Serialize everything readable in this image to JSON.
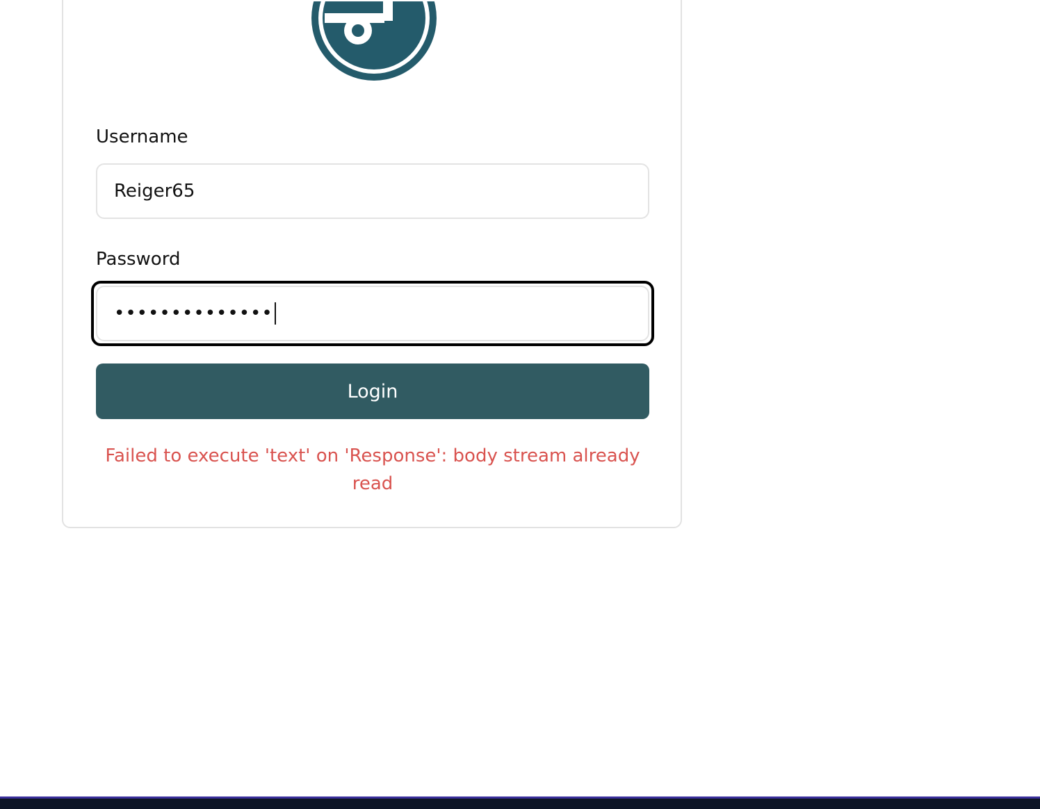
{
  "login_form": {
    "username_label": "Username",
    "username_value": "Reiger65",
    "password_label": "Password",
    "password_masked": "••••••••••••••",
    "login_button": "Login",
    "error_message": "Failed to execute 'text' on 'Response': body stream already read"
  },
  "colors": {
    "brand": "#245b6b",
    "button": "#315b62",
    "error": "#d9534f"
  },
  "icons": {
    "logo": "s-circle-logo-icon"
  }
}
